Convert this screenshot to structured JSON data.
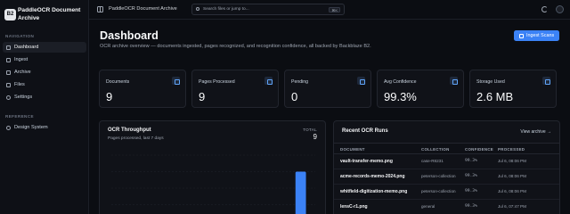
{
  "brand": {
    "logo": "B2",
    "name": "PaddleOCR Document Archive"
  },
  "sidebar": {
    "sections": [
      {
        "heading": "NAVIGATION",
        "items": [
          {
            "label": "Dashboard",
            "icon": "dashboard-icon",
            "active": true
          },
          {
            "label": "Ingest",
            "icon": "upload-icon"
          },
          {
            "label": "Archive",
            "icon": "archive-icon"
          },
          {
            "label": "Files",
            "icon": "file-icon"
          },
          {
            "label": "Settings",
            "icon": "gear-icon"
          }
        ]
      },
      {
        "heading": "REFERENCE",
        "items": [
          {
            "label": "Design System",
            "icon": "palette-icon"
          }
        ]
      }
    ]
  },
  "topbar": {
    "title": "PaddleOCR Document Archive",
    "search_placeholder": "Search files or jump to...",
    "search_shortcut": "⌘K"
  },
  "page": {
    "title": "Dashboard",
    "subtitle": "OCR archive overview — documents ingested, pages recognized, and recognition confidence, all backed by Backblaze B2.",
    "ingest_button": "Ingest Scans"
  },
  "stats": [
    {
      "label": "Documents",
      "value": "9",
      "icon": "document-icon"
    },
    {
      "label": "Pages Processed",
      "value": "9",
      "icon": "clock-icon"
    },
    {
      "label": "Pending",
      "value": "0",
      "icon": "hourglass-icon"
    },
    {
      "label": "Avg Confidence",
      "value": "99.3%",
      "icon": "gauge-icon"
    },
    {
      "label": "Storage Used",
      "value": "2.6 MB",
      "icon": "storage-icon"
    }
  ],
  "throughput": {
    "title": "OCR Throughput",
    "subtitle": "Pages processed, last 7 days",
    "total_label": "TOTAL",
    "total_value": "9"
  },
  "chart_data": {
    "type": "bar",
    "categories": [
      "",
      "",
      "",
      "",
      "",
      "",
      ""
    ],
    "values": [
      0,
      0,
      0,
      0,
      0,
      0,
      9
    ],
    "ylim": [
      0,
      12
    ],
    "grid": true,
    "color": "#3b82f6"
  },
  "runs": {
    "title": "Recent OCR Runs",
    "view_link": "View archive →",
    "columns": [
      "DOCUMENT",
      "COLLECTION",
      "CONFIDENCE",
      "PROCESSED"
    ],
    "rows": [
      {
        "document": "vault-transfer-memo.png",
        "collection": "case-R8231",
        "confidence": "99.3%",
        "processed": "Jul 6, 08:06 PM"
      },
      {
        "document": "acme-records-memo-2024.png",
        "collection": "peterson-collection",
        "confidence": "99.3%",
        "processed": "Jul 6, 08:06 PM"
      },
      {
        "document": "whitfield-digitization-memo.png",
        "collection": "peterson-collection",
        "confidence": "99.3%",
        "processed": "Jul 6, 08:06 PM"
      },
      {
        "document": "lensC-r1.png",
        "collection": "general",
        "confidence": "99.3%",
        "processed": "Jul 6, 07:47 PM"
      }
    ]
  }
}
